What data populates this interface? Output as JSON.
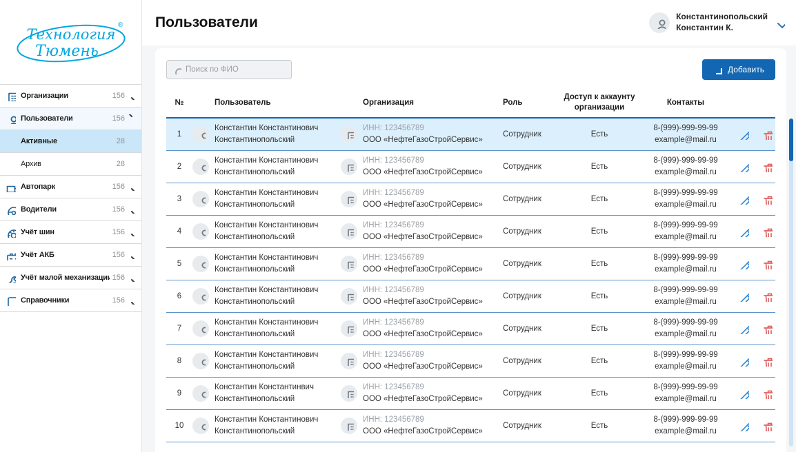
{
  "brand": {
    "name_line1": "Технология",
    "name_line2": "Тюмень",
    "reg_mark": "®",
    "color": "#00a7e0"
  },
  "header": {
    "title": "Пользователи",
    "user": {
      "name_line1": "Константинопольский",
      "name_line2": "Константин К."
    }
  },
  "sidebar": {
    "items": [
      {
        "label": "Организации",
        "count": "156",
        "icon": "building"
      },
      {
        "label": "Пользователи",
        "count": "156",
        "icon": "user",
        "expanded": true,
        "children": [
          {
            "label": "Активные",
            "count": "28",
            "active": true
          },
          {
            "label": "Архив",
            "count": "28"
          }
        ]
      },
      {
        "label": "Автопарк",
        "count": "156",
        "icon": "truck"
      },
      {
        "label": "Водители",
        "count": "156",
        "icon": "steering"
      },
      {
        "label": "Учёт шин",
        "count": "156",
        "icon": "tire"
      },
      {
        "label": "Учёт АКБ",
        "count": "156",
        "icon": "battery"
      },
      {
        "label": "Учёт малой механизации",
        "count": "156",
        "icon": "wrench"
      },
      {
        "label": "Справочники",
        "count": "156",
        "icon": "book"
      }
    ]
  },
  "toolbar": {
    "search_placeholder": "Поиск по ФИО",
    "add_button": "Добавить"
  },
  "table": {
    "columns": {
      "num": "№",
      "user": "Пользователь",
      "org": "Организация",
      "role": "Роль",
      "access": "Доступ к аккаунту организации",
      "contacts": "Контакты"
    },
    "rows": [
      {
        "num": "1",
        "selected": true,
        "user1": "Константин Константинович",
        "user2": "Константинопольский",
        "inn": "ИНН: 123456789",
        "org": "ООО «НефтеГазоСтройСервис»",
        "role": "Сотрудник",
        "access": "Есть",
        "phone": "8-(999)-999-99-99",
        "email": "example@mail.ru"
      },
      {
        "num": "2",
        "user1": "Константин Константинович",
        "user2": "Константинопольский",
        "inn": "ИНН: 123456789",
        "org": "ООО «НефтеГазоСтройСервис»",
        "role": "Сотрудник",
        "access": "Есть",
        "phone": "8-(999)-999-99-99",
        "email": "example@mail.ru"
      },
      {
        "num": "3",
        "user1": "Константин Константинович",
        "user2": "Константинопольский",
        "inn": "ИНН: 123456789",
        "org": "ООО «НефтеГазоСтройСервис»",
        "role": "Сотрудник",
        "access": "Есть",
        "phone": "8-(999)-999-99-99",
        "email": "example@mail.ru"
      },
      {
        "num": "4",
        "user1": "Константин Константинович",
        "user2": "Константинопольский",
        "inn": "ИНН: 123456789",
        "org": "ООО «НефтеГазоСтройСервис»",
        "role": "Сотрудник",
        "access": "Есть",
        "phone": "8-(999)-999-99-99",
        "email": "example@mail.ru"
      },
      {
        "num": "5",
        "user1": "Константин Константинович",
        "user2": "Константинопольский",
        "inn": "ИНН: 123456789",
        "org": "ООО «НефтеГазоСтройСервис»",
        "role": "Сотрудник",
        "access": "Есть",
        "phone": "8-(999)-999-99-99",
        "email": "example@mail.ru"
      },
      {
        "num": "6",
        "user1": "Константин Константинович",
        "user2": "Константинопольский",
        "inn": "ИНН: 123456789",
        "org": "ООО «НефтеГазоСтройСервис»",
        "role": "Сотрудник",
        "access": "Есть",
        "phone": "8-(999)-999-99-99",
        "email": "example@mail.ru"
      },
      {
        "num": "7",
        "user1": "Константин Константинович",
        "user2": "Константинопольский",
        "inn": "ИНН: 123456789",
        "org": "ООО «НефтеГазоСтройСервис»",
        "role": "Сотрудник",
        "access": "Есть",
        "phone": "8-(999)-999-99-99",
        "email": "example@mail.ru"
      },
      {
        "num": "8",
        "user1": "Константин Константинович",
        "user2": "Константинопольский",
        "inn": "ИНН: 123456789",
        "org": "ООО «НефтеГазоСтройСервис»",
        "role": "Сотрудник",
        "access": "Есть",
        "phone": "8-(999)-999-99-99",
        "email": "example@mail.ru"
      },
      {
        "num": "9",
        "user1": "Константин Константинвич",
        "user2": "Константинопольский",
        "inn": "ИНН: 123456789",
        "org": "ООО «НефтеГазоСтройСервис»",
        "role": "Сотрудник",
        "access": "Есть",
        "phone": "8-(999)-999-99-99",
        "email": "example@mail.ru"
      },
      {
        "num": "10",
        "user1": "Константин Константинович",
        "user2": "Константинопольский",
        "inn": "ИНН: 123456789",
        "org": "ООО «НефтеГазоСтройСервис»",
        "role": "Сотрудник",
        "access": "Есть",
        "phone": "8-(999)-999-99-99",
        "email": "example@mail.ru"
      }
    ]
  },
  "colors": {
    "accent": "#1266b2",
    "logo": "#00a7e0",
    "row_divider": "#5b93c9",
    "selected_row_bg": "#dceffc",
    "edit_icon": "#3b8ed6",
    "delete_icon": "#e06060"
  }
}
